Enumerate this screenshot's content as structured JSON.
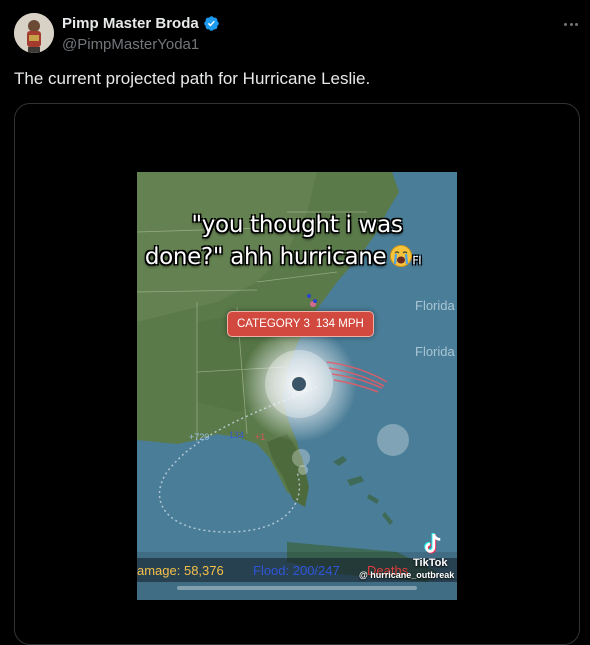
{
  "author": {
    "display_name": "Pimp Master Broda",
    "handle": "@PimpMasterYoda1",
    "verified": true
  },
  "tweet": {
    "text": "The current projected path for Hurricane Leslie."
  },
  "video": {
    "caption_line1": "\"you thought i was",
    "caption_line2": "done?\" ahh hurricane",
    "caption_emoji": "loudly-crying-face",
    "caption_tail": "Fl",
    "map_labels": [
      "Florida",
      "Florida"
    ],
    "category_label": "CATEGORY 3",
    "wind_speed": "134 MPH",
    "track_labels": [
      "+720",
      "134",
      "+1"
    ],
    "stats": {
      "damage": "amage: 58,376",
      "flood": "Flood: 200/247",
      "deaths": "Deaths"
    },
    "watermark": {
      "brand": "TikTok",
      "user": "@ hurricane_outbreak"
    }
  },
  "colors": {
    "background": "#000000",
    "text": "#e7e9ea",
    "muted": "#71767b",
    "verified": "#1d9bf0",
    "category_badge": "#d24a3f",
    "damage": "#f4c04a",
    "flood": "#2f55d8",
    "deaths": "#e23b3b"
  }
}
